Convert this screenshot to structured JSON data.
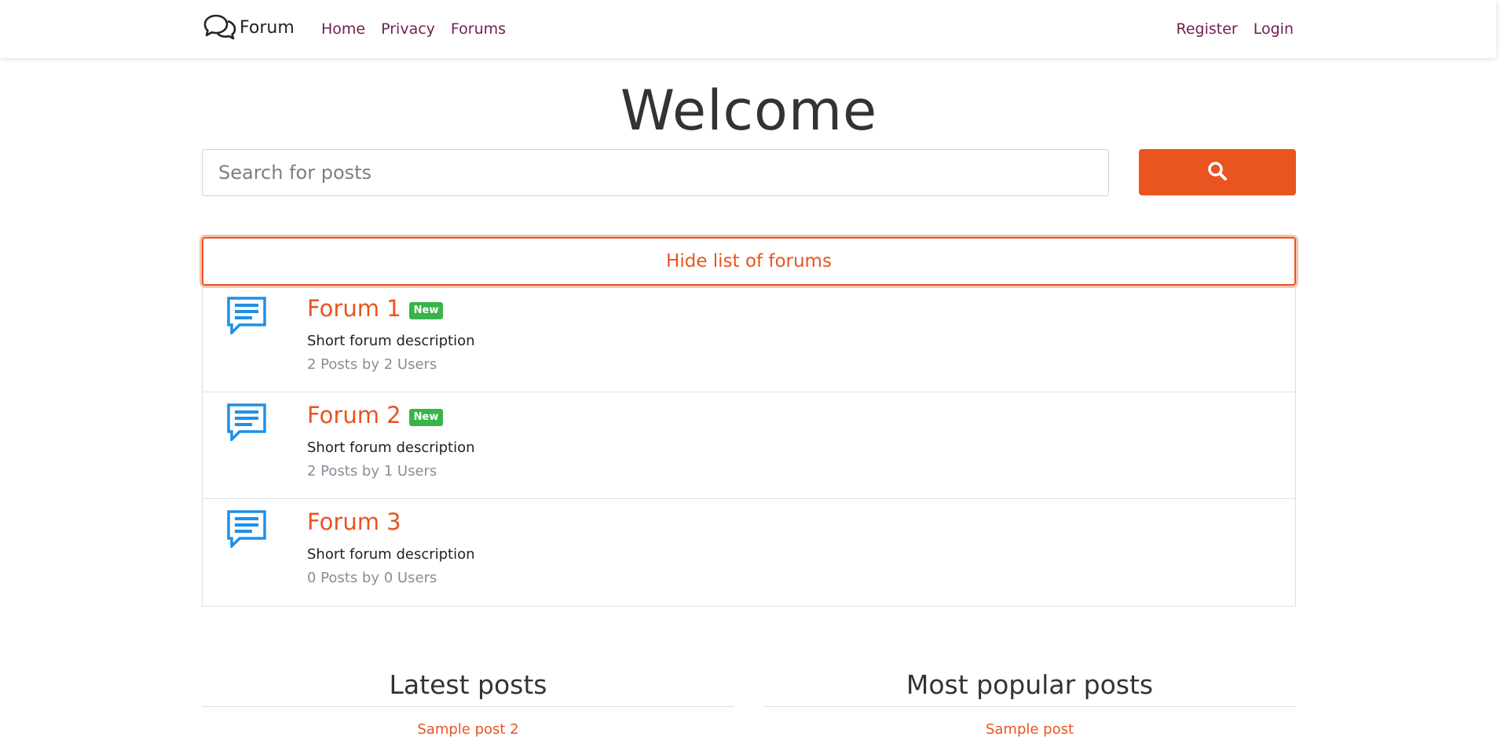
{
  "navbar": {
    "brand": "Forum",
    "links": [
      "Home",
      "Privacy",
      "Forums"
    ],
    "right_links": [
      "Register",
      "Login"
    ]
  },
  "main": {
    "title": "Welcome",
    "search": {
      "placeholder": "Search for posts",
      "value": "",
      "button_icon": "search-icon"
    },
    "toggle_label": "Hide list of forums",
    "forums": [
      {
        "title": "Forum 1",
        "badge": "New",
        "description": "Short forum description",
        "stats": "2 Posts by 2 Users",
        "icon": "forum-chat-icon"
      },
      {
        "title": "Forum 2",
        "badge": "New",
        "description": "Short forum description",
        "stats": "2 Posts by 1 Users",
        "icon": "forum-chat-icon"
      },
      {
        "title": "Forum 3",
        "badge": "",
        "description": "Short forum description",
        "stats": "0 Posts by 0 Users",
        "icon": "forum-chat-icon"
      }
    ],
    "latest": {
      "heading": "Latest posts",
      "items": [
        "Sample post 2"
      ]
    },
    "popular": {
      "heading": "Most popular posts",
      "items": [
        "Sample post"
      ]
    }
  },
  "colors": {
    "accent": "#e95420",
    "nav_link": "#6f2150",
    "badge": "#38b44a",
    "forum_icon": "#1e90e8"
  }
}
